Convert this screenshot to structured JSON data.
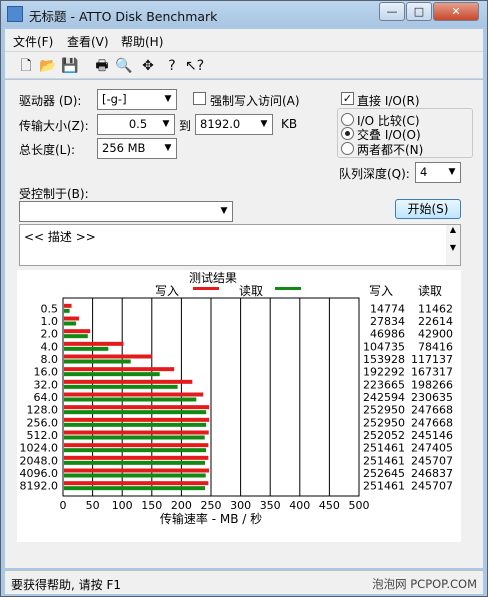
{
  "window": {
    "title": "无标题 - ATTO Disk Benchmark",
    "min": "—",
    "max": "□",
    "close": "✕"
  },
  "menu": [
    "文件(F)",
    "查看(V)",
    "帮助(H)"
  ],
  "toolbar": [
    "new-icon",
    "open-icon",
    "save-icon",
    "print-icon",
    "print-preview-icon",
    "move-icon",
    "help-icon",
    "context-help-icon"
  ],
  "form": {
    "drive_label": "驱动器 (D):",
    "drive_value": "[-g-]",
    "force_write_label": "强制写入访问(A)",
    "force_write_checked": false,
    "direct_io_label": "直接 I/O(R)",
    "direct_io_checked": true,
    "transfer_size_label": "传输大小(Z):",
    "transfer_from": "0.5",
    "to_label": "到",
    "transfer_to": "8192.0",
    "unit_kb": "KB",
    "total_length_label": "总长度(L):",
    "total_length": "256 MB",
    "io_compare_label": "I/O 比较(C)",
    "overlapped_io_label": "交叠 I/O(O)",
    "neither_label": "两者都不(N)",
    "selected_mode": "overlapped",
    "queue_depth_label": "队列深度(Q):",
    "queue_depth": "4",
    "controlled_by_label": "受控制于(B):",
    "controlled_by_value": "",
    "start_button": "开始(S)",
    "description": "<< 描述 >>"
  },
  "results": {
    "title": "测试结果",
    "legend_write": "写入",
    "legend_read": "读取",
    "col_write": "写入",
    "col_read": "读取",
    "xlabel": "传输速率 - MB / 秒",
    "colors": {
      "write": "#e31b1b",
      "read": "#128a12",
      "grid": "#000000"
    }
  },
  "chart_data": {
    "type": "bar",
    "orientation": "horizontal",
    "title": "测试结果",
    "xlabel": "传输速率 - MB / 秒",
    "xlim": [
      0,
      500
    ],
    "xticks": [
      0,
      50,
      100,
      150,
      200,
      250,
      300,
      350,
      400,
      450,
      500
    ],
    "categories": [
      "0.5",
      "1.0",
      "2.0",
      "4.0",
      "8.0",
      "16.0",
      "32.0",
      "64.0",
      "128.0",
      "256.0",
      "512.0",
      "1024.0",
      "2048.0",
      "4096.0",
      "8192.0"
    ],
    "series": [
      {
        "name": "写入",
        "color": "#e31b1b",
        "values": [
          14774,
          27834,
          46986,
          104735,
          153928,
          192292,
          223665,
          242594,
          252950,
          252950,
          252052,
          251461,
          251461,
          252645,
          251461
        ]
      },
      {
        "name": "读取",
        "color": "#128a12",
        "values": [
          11462,
          22614,
          42900,
          78416,
          117137,
          167317,
          198266,
          230635,
          247668,
          247668,
          245146,
          247405,
          245707,
          246837,
          245707
        ]
      }
    ]
  },
  "status": {
    "text": "要获得帮助, 请按 F1",
    "watermark": "泡泡网 PCPOP.COM"
  }
}
